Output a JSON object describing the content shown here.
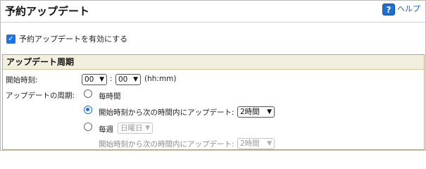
{
  "header": {
    "title": "予約アップデート",
    "help_label": "ヘルプ",
    "help_icon": "?"
  },
  "enable": {
    "label": "予約アップデートを有効にする",
    "checked": true
  },
  "section": {
    "title": "アップデート周期",
    "start_time_label": "開始時刻:",
    "hour": "00",
    "separator": ":",
    "minute": "00",
    "time_format": "(hh:mm)",
    "cycle_label": "アップデートの周期:",
    "options": {
      "hourly": "毎時間",
      "within_hours": "開始時刻から次の時間内にアップデート:",
      "within_hours_value": "2時間",
      "weekly": "毎週",
      "weekday_value": "日曜日",
      "weekly_within": "開始時刻から次の時間内にアップデート:",
      "weekly_within_value": "2時間"
    },
    "selected_option": "within_hours"
  },
  "colors": {
    "accent": "#1a73e8",
    "section_header_bg": "#f3efdf",
    "link": "#1a5fc4"
  }
}
